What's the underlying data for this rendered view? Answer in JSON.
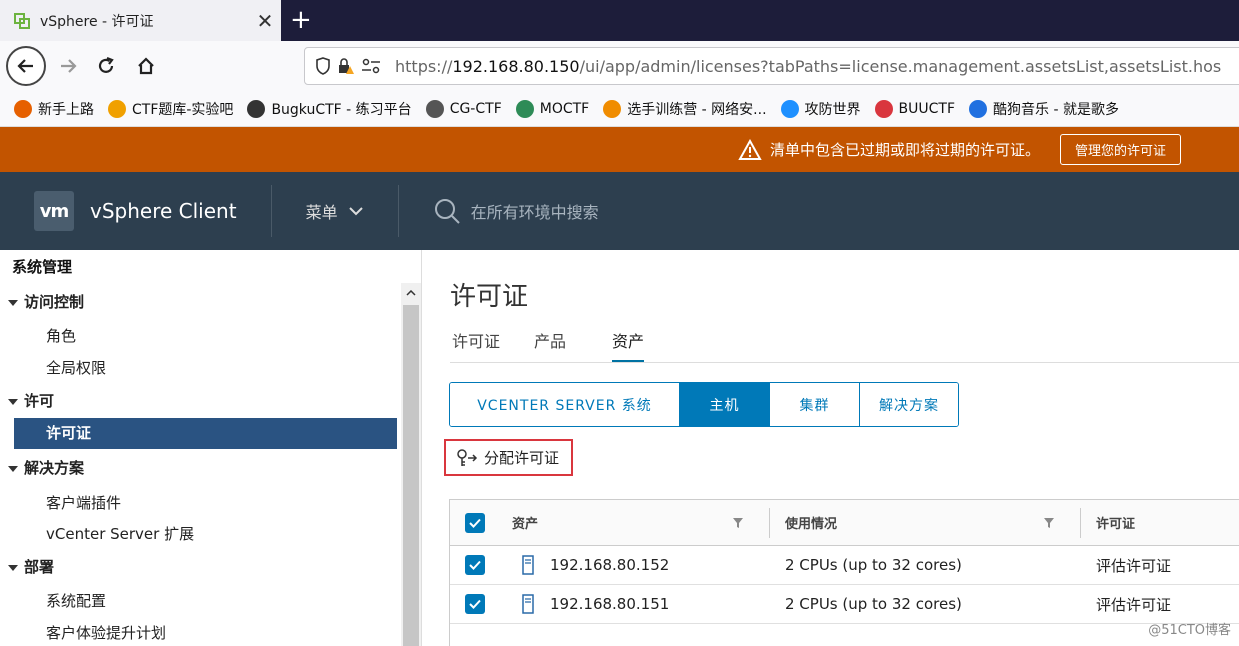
{
  "browser": {
    "tab_title": "vSphere - 许可证",
    "url_prefix": "https://",
    "url_host": "192.168.80.150",
    "url_rest": "/ui/app/admin/licenses?tabPaths=license.management.assetsList,assetsList.hos",
    "bookmarks": [
      {
        "label": "新手上路",
        "color": "#e66000"
      },
      {
        "label": "CTF题库-实验吧",
        "color": "#f0a000"
      },
      {
        "label": "BugkuCTF - 练习平台",
        "color": "#333333"
      },
      {
        "label": "CG-CTF",
        "color": "#555555"
      },
      {
        "label": "MOCTF",
        "color": "#2e8b57"
      },
      {
        "label": "选手训练营 - 网络安...",
        "color": "#f08c00"
      },
      {
        "label": "攻防世界",
        "color": "#1e90ff"
      },
      {
        "label": "BUUCTF",
        "color": "#d9363e"
      },
      {
        "label": "酷狗音乐 - 就是歌多",
        "color": "#2070e0"
      }
    ]
  },
  "banner": {
    "message": "清单中包含已过期或即将过期的许可证。",
    "button": "管理您的许可证"
  },
  "header": {
    "logo": "vm",
    "title": "vSphere Client",
    "menu": "菜单",
    "search_placeholder": "在所有环境中搜索"
  },
  "sidebar": {
    "title": "系统管理",
    "groups": [
      {
        "label": "访问控制",
        "children": [
          "角色",
          "全局权限"
        ]
      },
      {
        "label": "许可",
        "children": [
          "许可证"
        ]
      },
      {
        "label": "解决方案",
        "children": [
          "客户端插件",
          "vCenter Server 扩展"
        ]
      },
      {
        "label": "部署",
        "children": [
          "系统配置",
          "客户体验提升计划"
        ]
      }
    ],
    "active": "许可证"
  },
  "main": {
    "title": "许可证",
    "tabs": [
      "许可证",
      "产品",
      "资产"
    ],
    "active_tab": "资产",
    "segments": [
      "VCENTER SERVER 系统",
      "主机",
      "集群",
      "解决方案"
    ],
    "active_segment": "主机",
    "assign_button": "分配许可证",
    "columns": [
      "资产",
      "使用情况",
      "许可证"
    ],
    "rows": [
      {
        "asset": "192.168.80.152",
        "usage": "2 CPUs (up to 32 cores)",
        "license": "评估许可证"
      },
      {
        "asset": "192.168.80.151",
        "usage": "2 CPUs (up to 32 cores)",
        "license": "评估许可证"
      }
    ]
  },
  "watermark": "@51CTO博客"
}
